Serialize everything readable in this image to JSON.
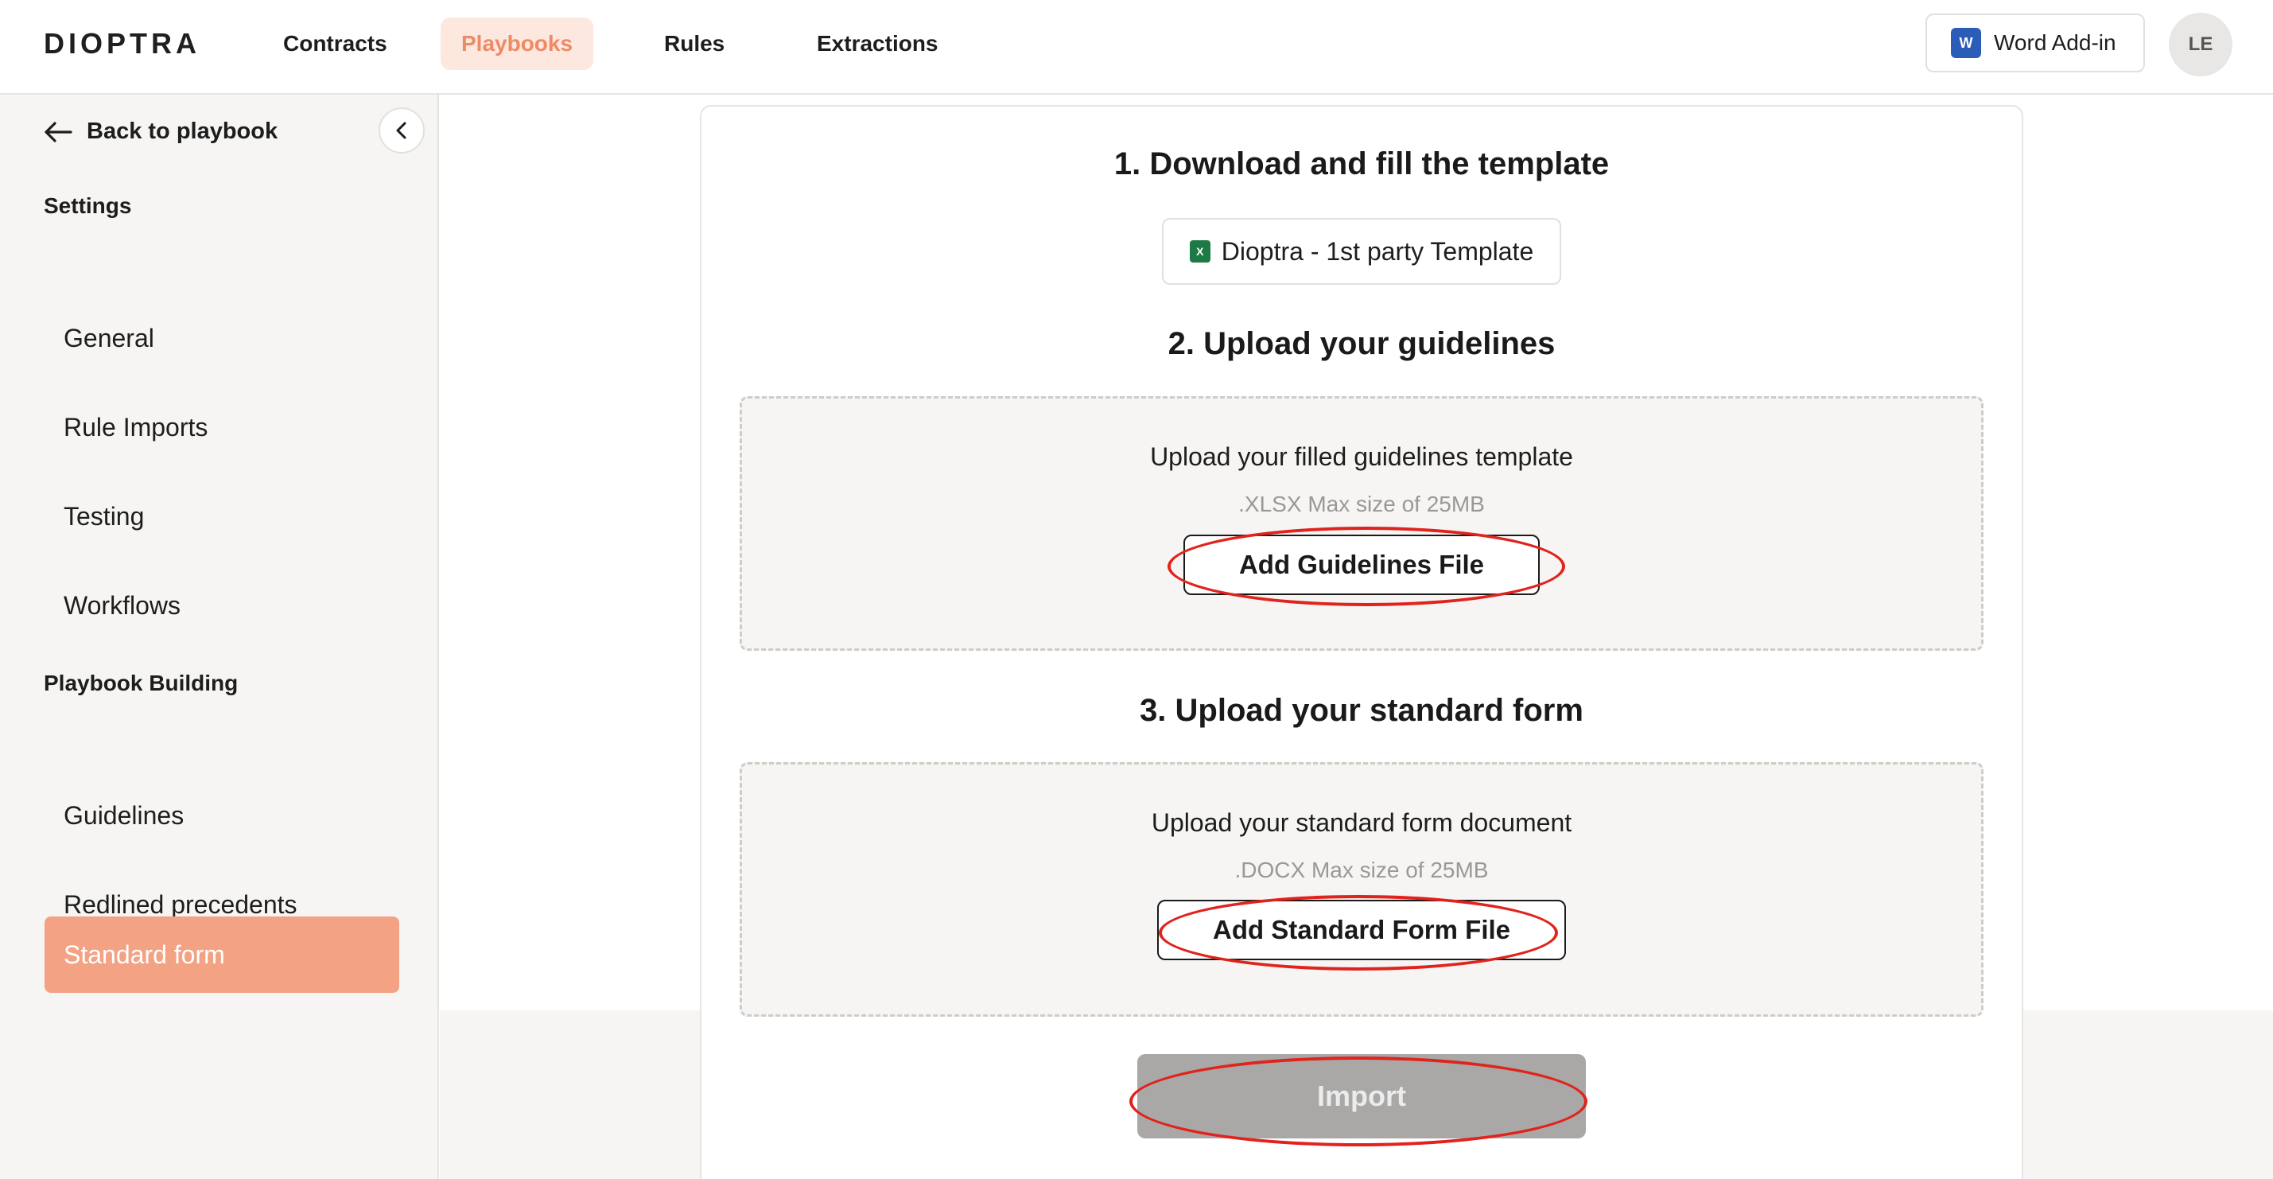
{
  "header": {
    "logo": "DIOPTRA",
    "nav": [
      "Contracts",
      "Playbooks",
      "Rules",
      "Extractions"
    ],
    "active_nav": "Playbooks",
    "word_addin_label": "Word Add-in",
    "word_icon_letter": "W",
    "avatar_initials": "LE"
  },
  "sidebar": {
    "back_label": "Back to playbook",
    "settings_title": "Settings",
    "settings_items": [
      "General",
      "Rule Imports",
      "Testing",
      "Workflows"
    ],
    "building_title": "Playbook Building",
    "building_items": [
      "Guidelines",
      "Redlined precedents",
      "Standard form"
    ],
    "active_item": "Standard form"
  },
  "main": {
    "step1_title": "1. Download and fill the template",
    "template_label": "Dioptra - 1st party Template",
    "step2_title": "2. Upload your guidelines",
    "guidelines_prompt": "Upload your filled guidelines template",
    "guidelines_format": ".XLSX Max size of 25MB",
    "guidelines_button": "Add Guidelines File",
    "step3_title": "3. Upload your standard form",
    "standard_prompt": "Upload your standard form document",
    "standard_format": ".DOCX Max size of 25MB",
    "standard_button": "Add Standard Form File",
    "import_button": "Import"
  },
  "colors": {
    "accent": "#f3a283",
    "nav_active_bg": "#fde8df",
    "nav_active_text": "#ee8a66",
    "annotation": "#e0231c",
    "import_disabled": "#a9a8a6"
  }
}
